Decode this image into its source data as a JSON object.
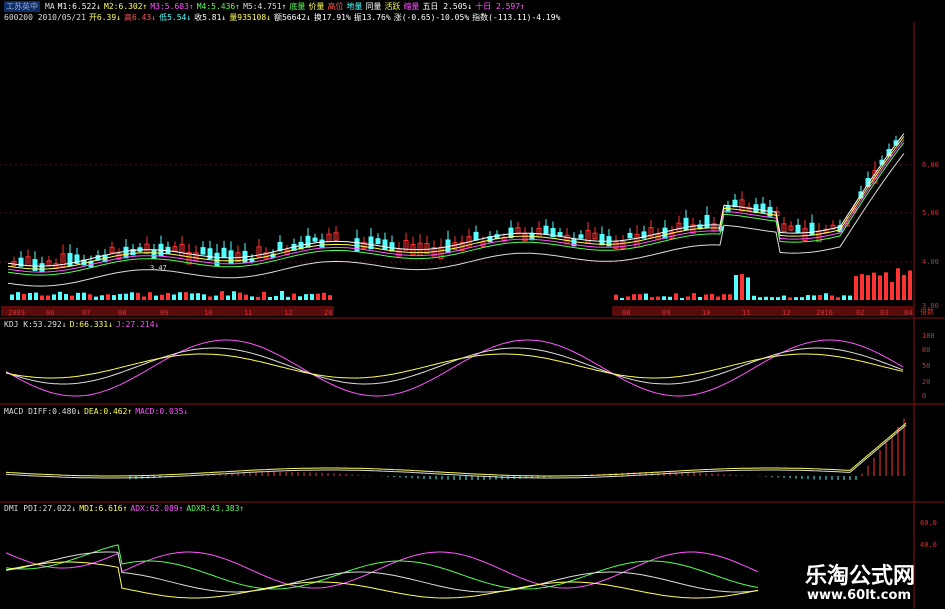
{
  "header": {
    "line1": [
      {
        "text": "工苏英中",
        "color": "#9ab"
      },
      {
        "text": "MA",
        "color": "#ddd"
      },
      {
        "text": "M1:6.522↓",
        "color": "#ffffff"
      },
      {
        "text": "M2:6.302↑",
        "color": "#ffff55"
      },
      {
        "text": "M3:5.683↑",
        "color": "#ff55ff"
      },
      {
        "text": "M4:5.436↑",
        "color": "#55ff55"
      },
      {
        "text": "M5:4.751↑",
        "color": "#dddddd"
      },
      {
        "text": "底量",
        "color": "#55ff55"
      },
      {
        "text": "价量",
        "color": "#ffff55"
      },
      {
        "text": "高位",
        "color": "#ff5555"
      },
      {
        "text": "地量",
        "color": "#55ffff"
      },
      {
        "text": "同量",
        "color": "#ffffff"
      },
      {
        "text": "活跃",
        "color": "#ffff55"
      },
      {
        "text": "缩量",
        "color": "#ff55ff"
      },
      {
        "text": "五日 2.505↓",
        "color": "#ffffff"
      },
      {
        "text": "十日 2.597↑",
        "color": "#ff55ff"
      }
    ],
    "line2": [
      {
        "text": "600200 2010/05/21",
        "color": "#dddddd"
      },
      {
        "text": "开6.39↓",
        "color": "#ffff55"
      },
      {
        "text": "高6.43↓",
        "color": "#ff5555"
      },
      {
        "text": "低5.54↓",
        "color": "#55ffff"
      },
      {
        "text": "收5.81↓",
        "color": "#ffffff"
      },
      {
        "text": "量935108↓",
        "color": "#ffff55"
      },
      {
        "text": "额56642↓",
        "color": "#ffffff"
      },
      {
        "text": "换17.91%",
        "color": "#ffffff"
      },
      {
        "text": "振13.76%",
        "color": "#ffffff"
      },
      {
        "text": "涨(-0.65)-10.05%",
        "color": "#ffffff"
      },
      {
        "text": "指数(-113.11)-4.19%",
        "color": "#ffffff"
      }
    ]
  },
  "kdj": [
    {
      "text": "KDJ K:53.292↓",
      "color": "#dddddd"
    },
    {
      "text": "D:66.331↓",
      "color": "#ffff55"
    },
    {
      "text": "J:27.214↓",
      "color": "#ff55ff"
    }
  ],
  "macd": [
    {
      "text": "MACD DIFF:0.480↓",
      "color": "#dddddd"
    },
    {
      "text": "DEA:0.462↑",
      "color": "#ffff55"
    },
    {
      "text": "MACD:0.035↓",
      "color": "#ff55ff"
    }
  ],
  "dmi": [
    {
      "text": "DMI PDI:27.022↓",
      "color": "#dddddd"
    },
    {
      "text": "MDI:6.616↑",
      "color": "#ffff55"
    },
    {
      "text": "ADX:62.089↑",
      "color": "#ff55ff"
    },
    {
      "text": "ADXR:43.383↑",
      "color": "#55ff55"
    }
  ],
  "axes": {
    "price_ticks": [
      "6.00",
      "5.00",
      "4.00",
      "3.00"
    ],
    "x_dates": [
      "2009",
      "06",
      "07",
      "08",
      "09",
      "10",
      "11",
      "12",
      "28",
      "08",
      "09",
      "10",
      "11",
      "12",
      "2010",
      "02",
      "03",
      "04"
    ],
    "kdj_ticks": [
      "100",
      "80",
      "50",
      "20",
      "0"
    ],
    "macd_ticks": [],
    "dmi_ticks": [
      "60.0",
      "40.0"
    ],
    "unit_label": "倍数"
  },
  "low_marker": "3.47",
  "watermark": {
    "name": "乐淘公式网",
    "url": "www.60lt.com"
  },
  "colors": {
    "up": "#ff3333",
    "down": "#55ffff",
    "ma1": "#ffffff",
    "ma2": "#ffff55",
    "ma3": "#ff55ff",
    "ma4": "#55ff55",
    "ma5": "#dddddd"
  }
}
